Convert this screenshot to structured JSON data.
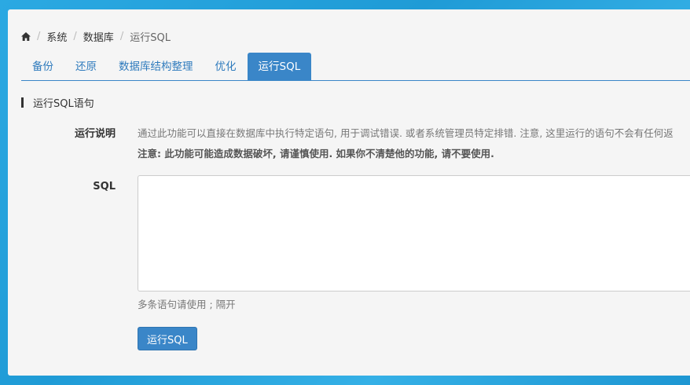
{
  "breadcrumb": {
    "items": [
      "系统",
      "数据库",
      "运行SQL"
    ]
  },
  "tabs": [
    {
      "label": "备份"
    },
    {
      "label": "还原"
    },
    {
      "label": "数据库结构整理"
    },
    {
      "label": "优化"
    },
    {
      "label": "运行SQL",
      "active": true
    }
  ],
  "section": {
    "title": "运行SQL语句"
  },
  "form": {
    "desc_label": "运行说明",
    "desc_text": "通过此功能可以直接在数据库中执行特定语句, 用于调试错误. 或者系统管理员特定排错. 注意, 这里运行的语句不会有任何返",
    "warning_text": "注意: 此功能可能造成数据破坏, 请谨慎使用. 如果你不清楚他的功能, 请不要使用.",
    "sql_label": "SQL",
    "sql_value": "",
    "hint": "多条语句请使用 ; 隔开",
    "run_button": "运行SQL"
  },
  "colors": {
    "accent": "#3a86c8",
    "background": "#2aa7df",
    "panel": "#f5f5f5"
  }
}
